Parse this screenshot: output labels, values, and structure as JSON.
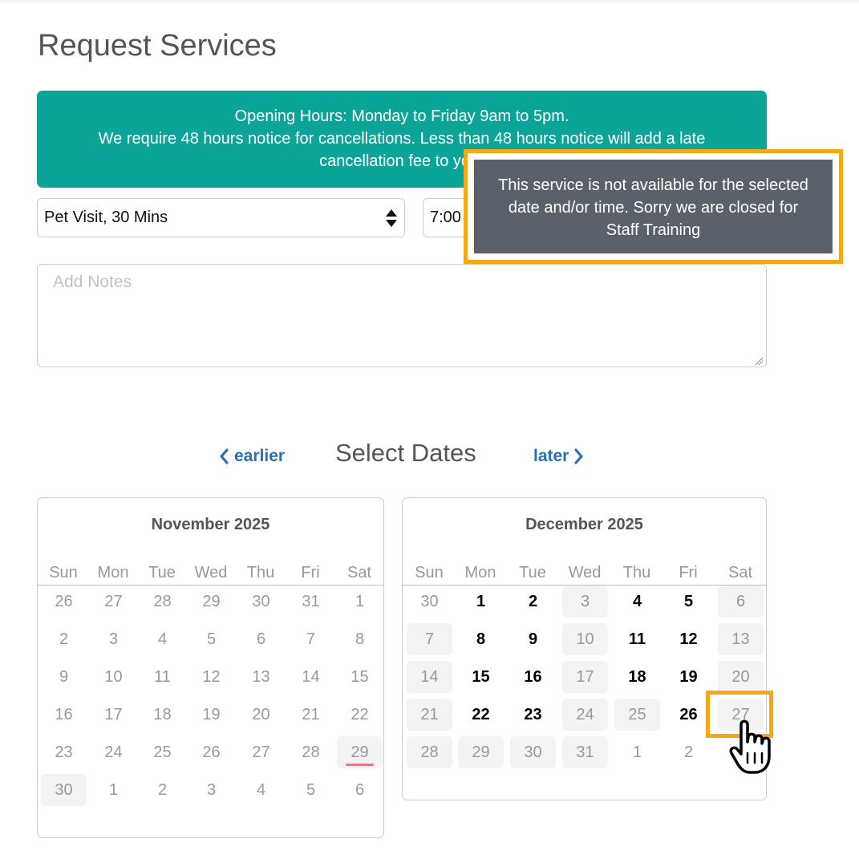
{
  "page": {
    "title": "Request Services"
  },
  "banner": {
    "line1": "Opening Hours: Monday to Friday 9am to 5pm.",
    "line2": "We require 48 hours notice for cancellations. Less than 48 hours notice will add a late",
    "line3": "cancellation fee to your"
  },
  "form": {
    "service_value": "Pet Visit, 30 Mins",
    "time_value": "7:00",
    "notes_placeholder": "Add Notes"
  },
  "tooltip": {
    "line1": "This service is not available for the selected",
    "line2": "date and/or time. Sorry we are closed for",
    "line3": "Staff Training"
  },
  "date_nav": {
    "earlier_label": "earlier",
    "title": "Select Dates",
    "later_label": "later"
  },
  "calendars": [
    {
      "title": "November 2025",
      "weekdays": [
        "Sun",
        "Mon",
        "Tue",
        "Wed",
        "Thu",
        "Fri",
        "Sat"
      ],
      "weeks": [
        [
          {
            "d": "26"
          },
          {
            "d": "27"
          },
          {
            "d": "28"
          },
          {
            "d": "29"
          },
          {
            "d": "30"
          },
          {
            "d": "31"
          },
          {
            "d": "1"
          }
        ],
        [
          {
            "d": "2"
          },
          {
            "d": "3"
          },
          {
            "d": "4"
          },
          {
            "d": "5"
          },
          {
            "d": "6"
          },
          {
            "d": "7"
          },
          {
            "d": "8"
          }
        ],
        [
          {
            "d": "9"
          },
          {
            "d": "10"
          },
          {
            "d": "11"
          },
          {
            "d": "12"
          },
          {
            "d": "13"
          },
          {
            "d": "14"
          },
          {
            "d": "15"
          }
        ],
        [
          {
            "d": "16"
          },
          {
            "d": "17"
          },
          {
            "d": "18"
          },
          {
            "d": "19"
          },
          {
            "d": "20"
          },
          {
            "d": "21"
          },
          {
            "d": "22"
          }
        ],
        [
          {
            "d": "23"
          },
          {
            "d": "24"
          },
          {
            "d": "25"
          },
          {
            "d": "26"
          },
          {
            "d": "27"
          },
          {
            "d": "28"
          },
          {
            "d": "29",
            "shade": true,
            "today": true
          }
        ],
        [
          {
            "d": "30",
            "shade": true
          },
          {
            "d": "1"
          },
          {
            "d": "2"
          },
          {
            "d": "3"
          },
          {
            "d": "4"
          },
          {
            "d": "5"
          },
          {
            "d": "6"
          }
        ]
      ]
    },
    {
      "title": "December 2025",
      "weekdays": [
        "Sun",
        "Mon",
        "Tue",
        "Wed",
        "Thu",
        "Fri",
        "Sat"
      ],
      "weeks": [
        [
          {
            "d": "30"
          },
          {
            "d": "1",
            "avail": true
          },
          {
            "d": "2",
            "avail": true
          },
          {
            "d": "3",
            "shade": true
          },
          {
            "d": "4",
            "avail": true
          },
          {
            "d": "5",
            "avail": true
          },
          {
            "d": "6",
            "shade": true
          }
        ],
        [
          {
            "d": "7",
            "shade": true
          },
          {
            "d": "8",
            "avail": true
          },
          {
            "d": "9",
            "avail": true
          },
          {
            "d": "10",
            "shade": true
          },
          {
            "d": "11",
            "avail": true
          },
          {
            "d": "12",
            "avail": true
          },
          {
            "d": "13",
            "shade": true
          }
        ],
        [
          {
            "d": "14",
            "shade": true
          },
          {
            "d": "15",
            "avail": true
          },
          {
            "d": "16",
            "avail": true
          },
          {
            "d": "17",
            "shade": true
          },
          {
            "d": "18",
            "avail": true
          },
          {
            "d": "19",
            "avail": true
          },
          {
            "d": "20",
            "shade": true
          }
        ],
        [
          {
            "d": "21",
            "shade": true
          },
          {
            "d": "22",
            "avail": true
          },
          {
            "d": "23",
            "avail": true
          },
          {
            "d": "24",
            "shade": true
          },
          {
            "d": "25",
            "shade": true
          },
          {
            "d": "26",
            "avail": true
          },
          {
            "d": "27",
            "shade": true
          }
        ],
        [
          {
            "d": "28",
            "shade": true
          },
          {
            "d": "29",
            "shade": true
          },
          {
            "d": "30",
            "shade": true
          },
          {
            "d": "31",
            "shade": true
          },
          {
            "d": "1"
          },
          {
            "d": "2"
          },
          {
            "d": ""
          }
        ]
      ]
    }
  ],
  "colors": {
    "banner_bg": "#0aa598",
    "tooltip_bg": "#5a616a",
    "highlight": "#f5a715",
    "link": "#2a6fb5",
    "today_marker": "#e8768f"
  },
  "icons": {
    "select_arrows": "sort-arrows-icon",
    "earlier": "chevron-left-icon",
    "later": "chevron-right-icon",
    "cursor": "hand-pointer-icon",
    "resize": "resize-grip-icon"
  }
}
